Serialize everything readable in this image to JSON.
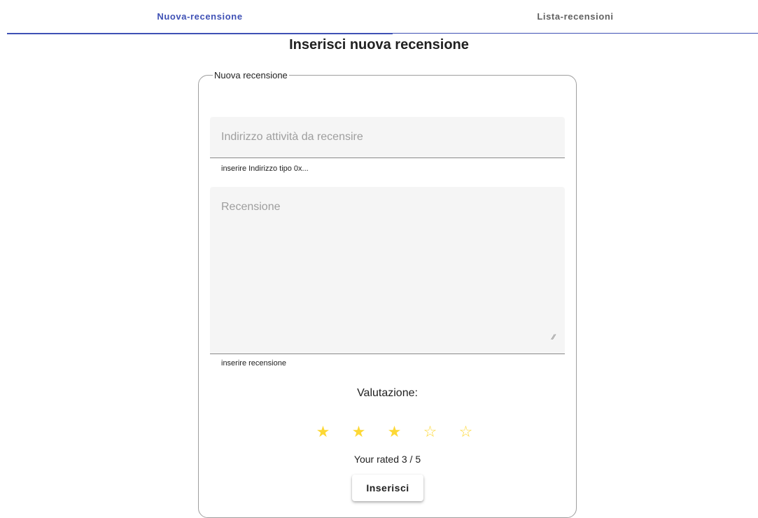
{
  "tabs": [
    {
      "label": "Nuova-recensione",
      "active": true
    },
    {
      "label": "Lista-recensioni",
      "active": false
    }
  ],
  "page": {
    "title": "Inserisci nuova recensione"
  },
  "form": {
    "legend": "Nuova recensione",
    "address": {
      "placeholder": "Indirizzo attività da recensire",
      "value": "",
      "hint": "inserire Indirizzo tipo 0x..."
    },
    "review": {
      "placeholder": "Recensione",
      "value": "",
      "hint": "inserire recensione"
    },
    "rating": {
      "label": "Valutazione:",
      "value": 3,
      "max": 5,
      "text": "Your rated 3 / 5",
      "filled_star": "★",
      "empty_star": "☆",
      "star_color": "#fdd835"
    },
    "submit_label": "Inserisci"
  },
  "colors": {
    "accent": "#3f51b5",
    "field_bg": "#f5f5f5"
  }
}
